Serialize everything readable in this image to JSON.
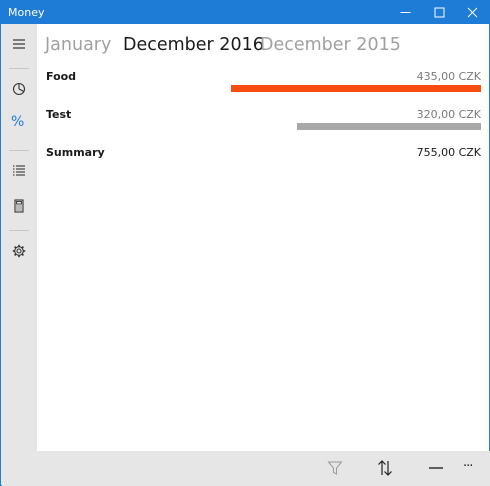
{
  "window": {
    "title": "Money",
    "accent_color": "#1e7bd6"
  },
  "titlebar_buttons": [
    {
      "name": "minimize-icon"
    },
    {
      "name": "maximize-icon"
    },
    {
      "name": "close-icon"
    }
  ],
  "sidebar": {
    "items": [
      {
        "icon": "hamburger-menu-icon"
      },
      {
        "icon": "pie-chart-icon"
      },
      {
        "icon": "percent-icon",
        "glyph": "%",
        "selected": true
      },
      {
        "icon": "list-icon"
      },
      {
        "icon": "calculator-icon"
      },
      {
        "icon": "gear-icon"
      }
    ]
  },
  "pivot": {
    "items": [
      {
        "label": "January",
        "active": false
      },
      {
        "label": "December 2016",
        "active": true
      },
      {
        "label": "December 2015",
        "active": false
      }
    ]
  },
  "categories": [
    {
      "name": "Food",
      "amount": "435,00 CZK",
      "share": 1.0,
      "bar_color": "#f74d11"
    },
    {
      "name": "Test",
      "amount": "320,00 CZK",
      "share": 0.7356,
      "bar_color": "#a8a8a8"
    }
  ],
  "summary": {
    "label": "Summary",
    "amount": "755,00 CZK"
  },
  "commandbar": {
    "buttons": [
      {
        "icon": "filter-icon",
        "enabled": false
      },
      {
        "icon": "sort-icon",
        "enabled": true
      },
      {
        "icon": "minus-icon",
        "enabled": true
      },
      {
        "icon": "more-icon",
        "glyph": "···",
        "enabled": true
      }
    ]
  }
}
